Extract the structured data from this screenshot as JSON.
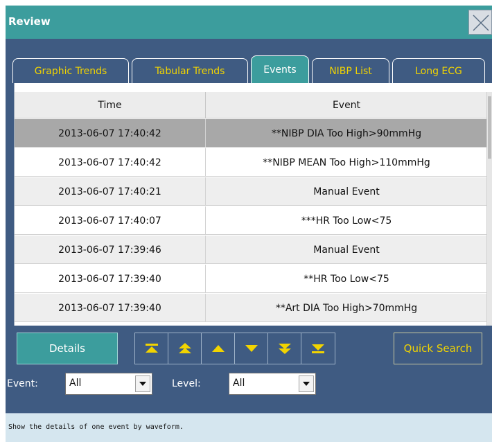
{
  "window": {
    "title": "Review"
  },
  "tabs": [
    {
      "label": "Graphic Trends",
      "active": false
    },
    {
      "label": "Tabular Trends",
      "active": false
    },
    {
      "label": "Events",
      "active": true
    },
    {
      "label": "NIBP List",
      "active": false
    },
    {
      "label": "Long ECG",
      "active": false
    }
  ],
  "table": {
    "columns": [
      "Time",
      "Event"
    ],
    "selected_row": 0,
    "rows": [
      {
        "time": "2013-06-07 17:40:42",
        "event": "**NIBP DIA Too High>90mmHg"
      },
      {
        "time": "2013-06-07 17:40:42",
        "event": "**NIBP MEAN Too High>110mmHg"
      },
      {
        "time": "2013-06-07 17:40:21",
        "event": "Manual Event"
      },
      {
        "time": "2013-06-07 17:40:07",
        "event": "***HR Too Low<75"
      },
      {
        "time": "2013-06-07 17:39:46",
        "event": "Manual Event"
      },
      {
        "time": "2013-06-07 17:39:40",
        "event": "**HR Too Low<75"
      },
      {
        "time": "2013-06-07 17:39:40",
        "event": "**Art DIA Too High>70mmHg"
      }
    ]
  },
  "controls": {
    "details_label": "Details",
    "nav_icons": [
      "first-page-icon",
      "page-up-icon",
      "line-up-icon",
      "line-down-icon",
      "page-down-icon",
      "last-page-icon"
    ],
    "quick_search_label": "Quick Search",
    "event_filter": {
      "label": "Event:",
      "value": "All"
    },
    "level_filter": {
      "label": "Level:",
      "value": "All"
    }
  },
  "status": {
    "text": "Show the details of one event by waveform."
  },
  "colors": {
    "panel": "#3f5b82",
    "teal": "#3c9d9d",
    "tab_text": "#f2d400",
    "selected_row": "#a8a8a8"
  }
}
